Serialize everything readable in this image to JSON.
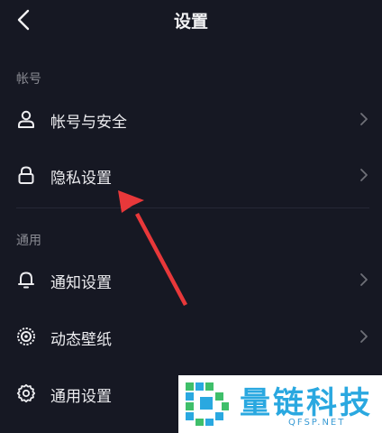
{
  "header": {
    "title": "设置",
    "back_icon": "chevron-left-icon"
  },
  "sections": [
    {
      "header": "帐号",
      "items": [
        {
          "label": "帐号与安全",
          "icon": "user-icon"
        },
        {
          "label": "隐私设置",
          "icon": "lock-icon"
        }
      ]
    },
    {
      "header": "通用",
      "items": [
        {
          "label": "通知设置",
          "icon": "bell-icon"
        },
        {
          "label": "动态壁纸",
          "icon": "live-wallpaper-icon"
        },
        {
          "label": "通用设置",
          "icon": "gear-icon"
        }
      ]
    }
  ],
  "colors": {
    "background": "#161823",
    "text": "#ececef",
    "section_text": "#8a8b93",
    "annotation_arrow": "#e8383a",
    "watermark_blue": "#2aa8e0",
    "watermark_green": "#3fbf6a"
  },
  "watermark": {
    "title": "量链科技",
    "url": "QFSP.NET"
  }
}
